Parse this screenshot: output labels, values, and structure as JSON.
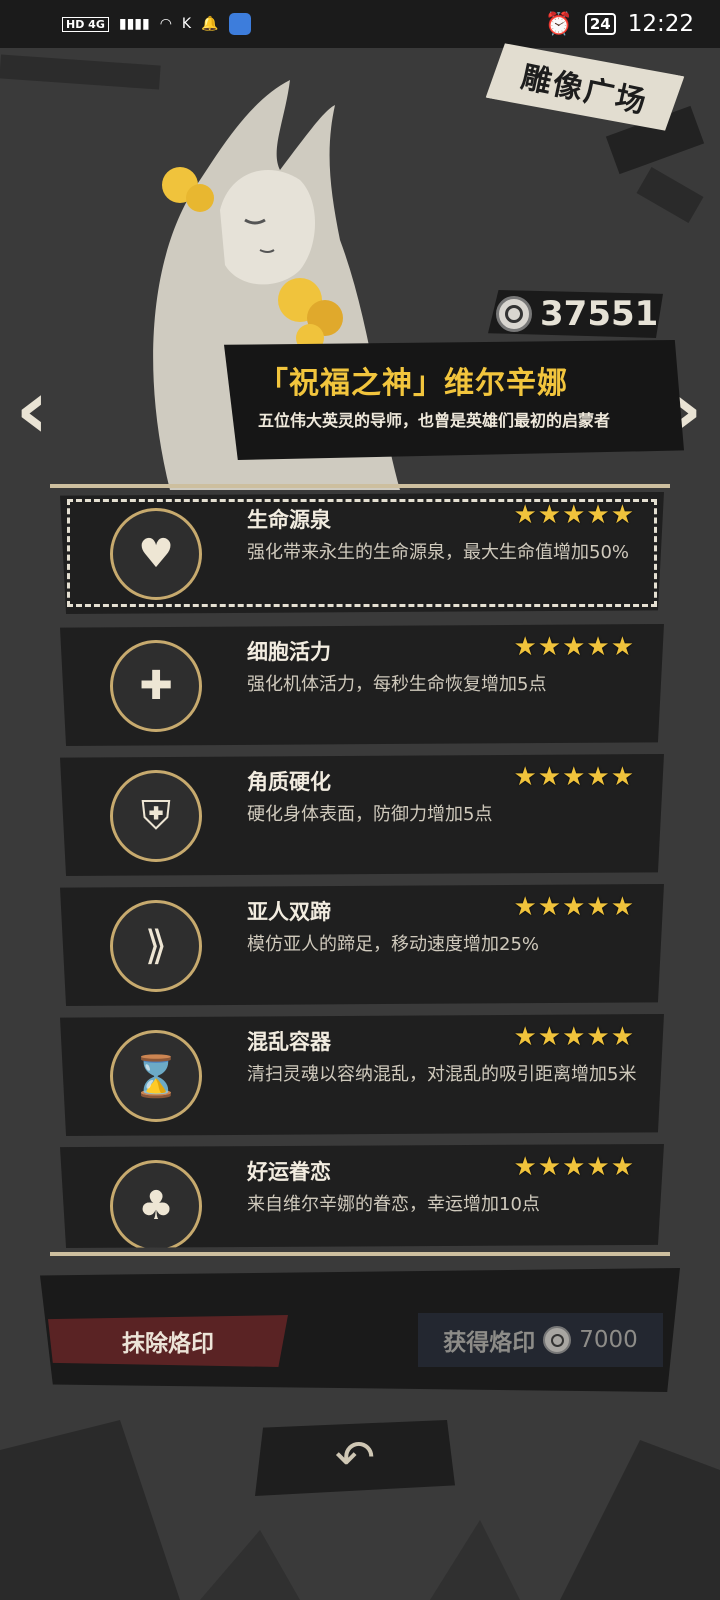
{
  "status_bar": {
    "network": "HD 4G",
    "battery": "24",
    "time": "12:22"
  },
  "header": {
    "title": "雕像广场",
    "currency": "37551"
  },
  "hero": {
    "name": "「祝福之神」维尔辛娜",
    "description": "五位伟大英灵的导师，也曾是英雄们最初的启蒙者"
  },
  "skills": [
    {
      "title": "生命源泉",
      "desc": "强化带来永生的生命源泉，最大生命值增加50%",
      "stars": 5,
      "icon": "heart-fountain-icon"
    },
    {
      "title": "细胞活力",
      "desc": "强化机体活力，每秒生命恢复增加5点",
      "stars": 5,
      "icon": "cells-icon"
    },
    {
      "title": "角质硬化",
      "desc": "硬化身体表面，防御力增加5点",
      "stars": 5,
      "icon": "armor-icon"
    },
    {
      "title": "亚人双蹄",
      "desc": "模仿亚人的蹄足，移动速度增加25%",
      "stars": 5,
      "icon": "hoof-icon"
    },
    {
      "title": "混乱容器",
      "desc": "清扫灵魂以容纳混乱，对混乱的吸引距离增加5米",
      "stars": 5,
      "icon": "container-icon"
    },
    {
      "title": "好运眷恋",
      "desc": "来自维尔辛娜的眷恋，幸运增加10点",
      "stars": 5,
      "icon": "clover-icon"
    }
  ],
  "actions": {
    "erase_label": "抹除烙印",
    "obtain_label": "获得烙印",
    "obtain_cost": "7000"
  },
  "colors": {
    "gold": "#f0c33c",
    "background": "#3a3a3a",
    "erase_button": "#5a2324"
  }
}
